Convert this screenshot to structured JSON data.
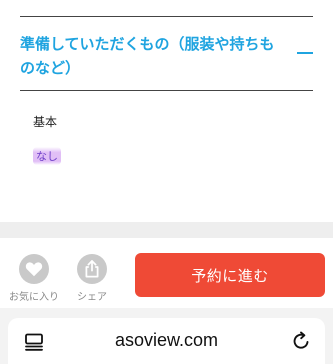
{
  "section": {
    "title": "準備していただくもの（服装や持ちものなど）"
  },
  "item": {
    "label": "基本",
    "value": "なし"
  },
  "actions": {
    "favorite_label": "お気に入り",
    "share_label": "シェア",
    "reserve_label": "予約に進む"
  },
  "browser": {
    "url": "asoview.com"
  },
  "colors": {
    "accent_blue": "#1fa4e0",
    "reserve_red": "#ef4a36",
    "highlight_purple": "#dcb4f5"
  },
  "icons": [
    "heart-icon",
    "share-icon",
    "reader-icon",
    "reload-icon"
  ]
}
